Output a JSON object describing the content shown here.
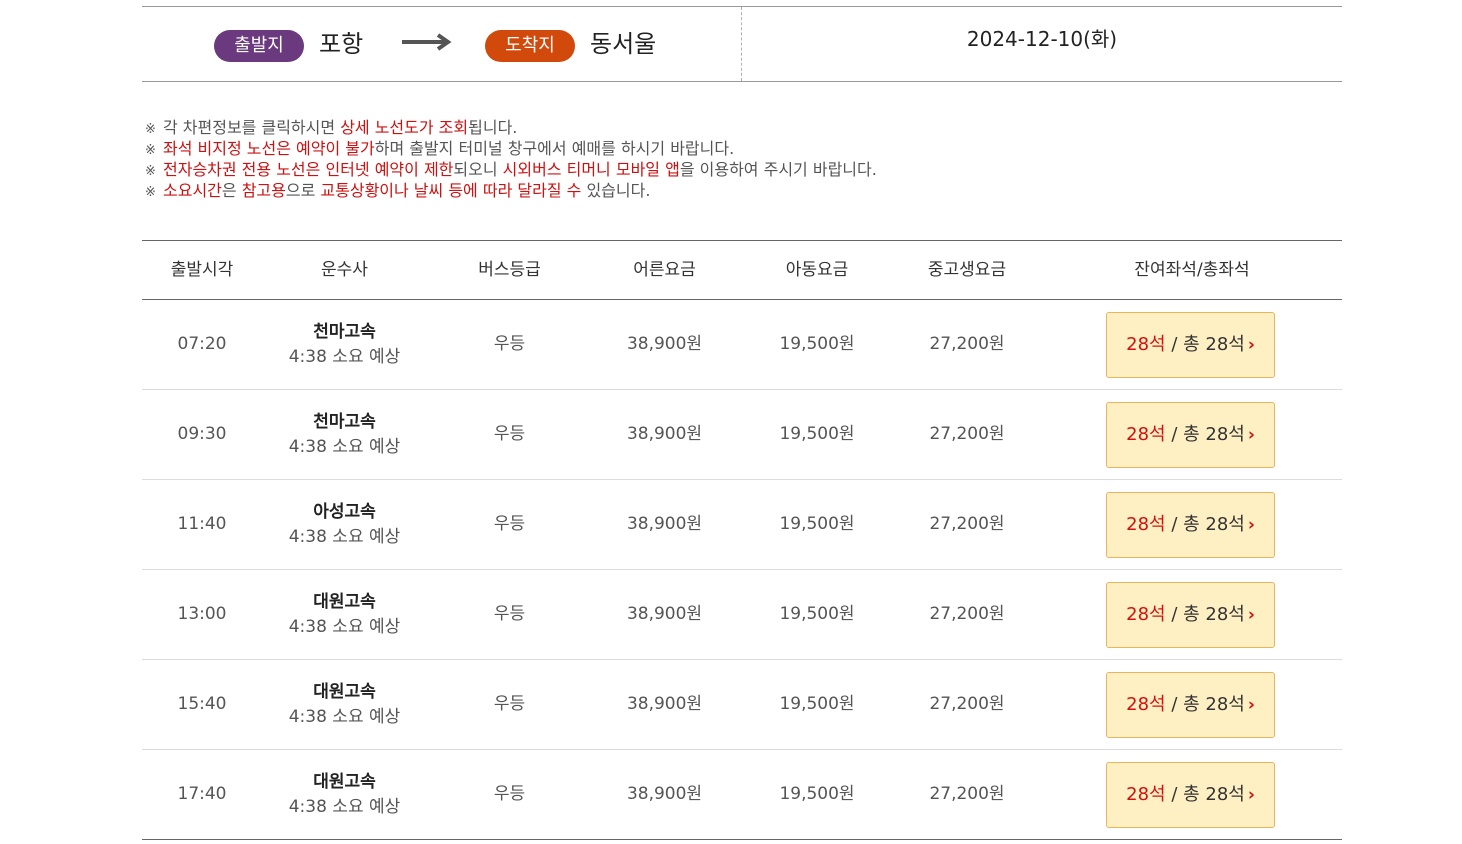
{
  "route": {
    "departure_badge": "출발지",
    "departure_city": "포항",
    "arrival_badge": "도착지",
    "arrival_city": "동서울",
    "date": "2024-12-10(화)",
    "arrow_icon": "right-arrow-icon"
  },
  "notices": [
    {
      "mark": "※",
      "parts": [
        {
          "text": "각 차편정보를 클릭하시면 ",
          "red": false
        },
        {
          "text": "상세 노선도가 조회",
          "red": true
        },
        {
          "text": "됩니다.",
          "red": false
        }
      ]
    },
    {
      "mark": "※",
      "parts": [
        {
          "text": "좌석 비지정 노선은 예약이 불가",
          "red": true
        },
        {
          "text": "하며 출발지 터미널 창구에서 예매를 하시기 바랍니다.",
          "red": false
        }
      ]
    },
    {
      "mark": "※",
      "parts": [
        {
          "text": "전자승차권 전용 노선은 인터넷 예약이 제한",
          "red": true
        },
        {
          "text": "되오니 ",
          "red": false
        },
        {
          "text": "시외버스 티머니 모바일 앱",
          "red": true
        },
        {
          "text": "을 이용하여 주시기 바랍니다.",
          "red": false
        }
      ]
    },
    {
      "mark": "※",
      "parts": [
        {
          "text": "소요시간",
          "red": true
        },
        {
          "text": "은 ",
          "red": false
        },
        {
          "text": "참고용",
          "red": true
        },
        {
          "text": "으로 ",
          "red": false
        },
        {
          "text": "교통상황이나 날씨 등에 따라 달라질 수",
          "red": true
        },
        {
          "text": " 있습니다.",
          "red": false
        }
      ]
    }
  ],
  "table": {
    "headers": {
      "time": "출발시각",
      "company": "운수사",
      "grade": "버스등급",
      "adult": "어른요금",
      "child": "아동요금",
      "teen": "중고생요금",
      "seats": "잔여좌석/총좌석"
    },
    "rows": [
      {
        "time": "07:20",
        "company": "천마고속",
        "duration": "4:38 소요 예상",
        "grade": "우등",
        "adult": "38,900원",
        "child": "19,500원",
        "teen": "27,200원",
        "remain": "28석",
        "total": " / 총 28석"
      },
      {
        "time": "09:30",
        "company": "천마고속",
        "duration": "4:38 소요 예상",
        "grade": "우등",
        "adult": "38,900원",
        "child": "19,500원",
        "teen": "27,200원",
        "remain": "28석",
        "total": " / 총 28석"
      },
      {
        "time": "11:40",
        "company": "아성고속",
        "duration": "4:38 소요 예상",
        "grade": "우등",
        "adult": "38,900원",
        "child": "19,500원",
        "teen": "27,200원",
        "remain": "28석",
        "total": " / 총 28석"
      },
      {
        "time": "13:00",
        "company": "대원고속",
        "duration": "4:38 소요 예상",
        "grade": "우등",
        "adult": "38,900원",
        "child": "19,500원",
        "teen": "27,200원",
        "remain": "28석",
        "total": " / 총 28석"
      },
      {
        "time": "15:40",
        "company": "대원고속",
        "duration": "4:38 소요 예상",
        "grade": "우등",
        "adult": "38,900원",
        "child": "19,500원",
        "teen": "27,200원",
        "remain": "28석",
        "total": " / 총 28석"
      },
      {
        "time": "17:40",
        "company": "대원고속",
        "duration": "4:38 소요 예상",
        "grade": "우등",
        "adult": "38,900원",
        "child": "19,500원",
        "teen": "27,200원",
        "remain": "28석",
        "total": " / 총 28석"
      }
    ],
    "seat_chevron_icon": "chevron-right-icon"
  },
  "colors": {
    "departure_badge": "#6b3a7e",
    "arrival_badge": "#d14a0b",
    "highlight_red": "#cc1111",
    "seat_button_bg": "#fff0c4",
    "seat_button_border": "#e8b45c"
  }
}
